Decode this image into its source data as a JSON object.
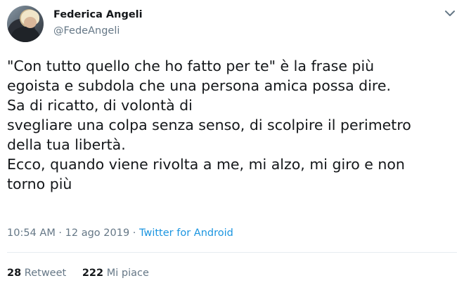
{
  "user": {
    "display_name": "Federica Angeli",
    "handle": "@FedeAngeli"
  },
  "menu_icon": "chevron-down-icon",
  "tweet": {
    "lines": [
      "\"Con tutto quello che ho fatto per te\" è la frase più",
      "egoista e subdola che una persona amica possa dire.",
      "Sa di ricatto, di volontà di",
      "svegliare una colpa senza senso, di scolpire il perimetro",
      "della tua libertà.",
      "Ecco, quando viene rivolta a me, mi alzo, mi giro e non",
      "torno più"
    ]
  },
  "meta": {
    "time": "10:54 AM",
    "separator": " · ",
    "date": "12 ago 2019",
    "separator2": " · ",
    "source": "Twitter for Android"
  },
  "stats": {
    "retweets_count": "28",
    "retweets_label": " Retweet",
    "likes_count": "222",
    "likes_label": " Mi piace"
  },
  "colors": {
    "text": "#14171a",
    "secondary": "#657786",
    "link": "#1b95e0",
    "divider": "#e6ecf0"
  }
}
